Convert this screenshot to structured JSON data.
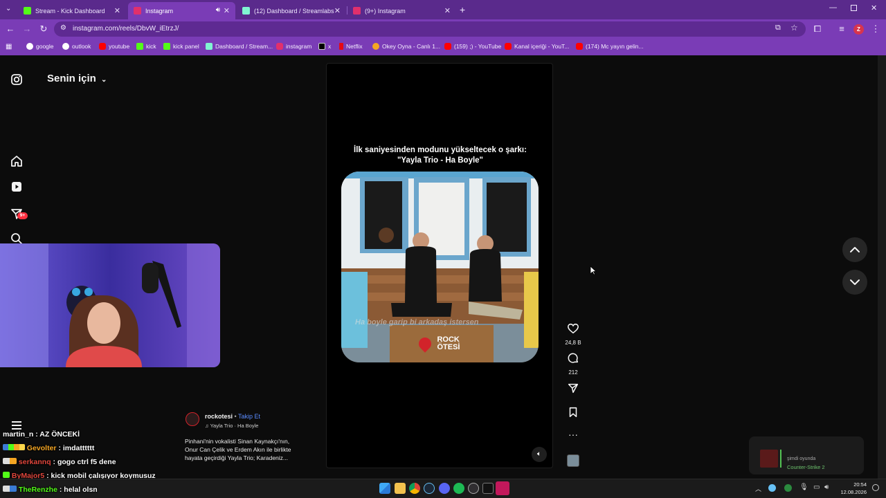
{
  "tabs": [
    {
      "title": "Stream - Kick Dashboard",
      "icon": "kick-icon",
      "color": "#53fc18"
    },
    {
      "title": "Instagram",
      "icon": "instagram-icon",
      "color": "#e1306c"
    },
    {
      "title": "(12) Dashboard / Streamlabs",
      "icon": "streamlabs-icon",
      "color": "#80f5d2"
    },
    {
      "title": "(9+) Instagram",
      "icon": "instagram-icon",
      "color": "#e1306c"
    }
  ],
  "url": "instagram.com/reels/DbvW_iEtrzJ/",
  "profile_letter": "Z",
  "bookmarks": [
    {
      "label": "google",
      "icon": "google-icon",
      "color": "#ffffff"
    },
    {
      "label": "outlook",
      "icon": "outlook-icon",
      "color": "#ffffff"
    },
    {
      "label": "youtube",
      "icon": "youtube-icon",
      "color": "#ff0000"
    },
    {
      "label": "kick",
      "icon": "kick-icon",
      "color": "#53fc18"
    },
    {
      "label": "kick panel",
      "icon": "kick-icon",
      "color": "#53fc18"
    },
    {
      "label": "Dashboard / Stream...",
      "icon": "streamlabs-icon",
      "color": "#80f5d2"
    },
    {
      "label": "instagram",
      "icon": "instagram-icon",
      "color": "#e1306c"
    },
    {
      "label": "x",
      "icon": "x-icon",
      "color": "#000000"
    },
    {
      "label": "Netflix",
      "icon": "netflix-icon",
      "color": "#e50914"
    },
    {
      "label": "Okey Oyna - Canlı 1...",
      "icon": "okey-icon",
      "color": "#f5a623"
    },
    {
      "label": "(159) ;) - YouTube",
      "icon": "youtube-icon",
      "color": "#ff0000"
    },
    {
      "label": "Kanal içeriği - YouT...",
      "icon": "youtube-icon",
      "color": "#ff0000"
    },
    {
      "label": "(174) Mc yayın gelin...",
      "icon": "youtube-icon",
      "color": "#ff0000"
    }
  ],
  "sidebar": {
    "title": "Senin için",
    "notification_badge": "9+"
  },
  "reel": {
    "caption_line1": "İlk saniyesinden modunu yükseltecek o şarkı:",
    "caption_line2": "\"Yayla Trio - Ha Boyle\"",
    "subtitle_overlay": "Ha boyle garip bi arkadaş istersen",
    "watermark_top": "ROCK",
    "watermark_bottom": "ÖTESİ",
    "author": "rockotesi",
    "follow_label": "Takip Et",
    "dot": "•",
    "audio": "Yayla Trio · Ha Boyle",
    "description_line1": "Pinhani'nin vokalisti Sinan Kaynakçı'nın,",
    "description_line2": "Onur Can Çelik ve Erdem Akın ile birlikte",
    "description_line3": "hayata geçirdiği Yayla Trio; Karadeniz...",
    "likes": "24,8 B",
    "comments": "212"
  },
  "chat": [
    {
      "user": "martin_n",
      "sep": ":",
      "text": "AZ ÖNCEKİ",
      "color": "#ffffff"
    },
    {
      "user": "Gevolter",
      "sep": ":",
      "text": "imdatttttt",
      "color": "#f5a623"
    },
    {
      "user": "serkannq",
      "sep": ":",
      "text": "gogo ctrl f5 dene",
      "color": "#e0463c"
    },
    {
      "user": "ByMajor5",
      "sep": ":",
      "text": "kick mobil çalışıyor koymusuz",
      "color": "#e0463c"
    },
    {
      "user": "TheRenzhe",
      "sep": ":",
      "text": "helal olsn",
      "color": "#53fc18"
    }
  ],
  "toast": {
    "line1": "şimdi oyunda",
    "line2": "Counter-Strike 2"
  },
  "clock": {
    "time": "20:54",
    "date": "12.08.2026"
  }
}
